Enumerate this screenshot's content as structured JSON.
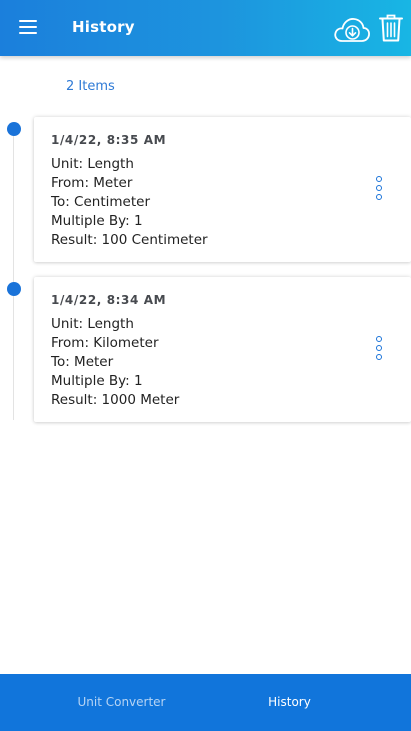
{
  "header": {
    "title": "History",
    "menu_icon": "hamburger-menu-icon",
    "download_icon": "cloud-download-icon",
    "delete_icon": "trash-icon"
  },
  "count_label": "2 Items",
  "history": [
    {
      "date": "1/4/22, 8:35 AM",
      "unit": "Unit: Length",
      "from": "From: Meter",
      "to": "To: Centimeter",
      "multiple": "Multiple By: 1",
      "result": "Result: 100 Centimeter"
    },
    {
      "date": "1/4/22, 8:34 AM",
      "unit": "Unit: Length",
      "from": "From: Kilometer",
      "to": "To: Meter",
      "multiple": "Multiple By: 1",
      "result": "Result: 1000 Meter"
    }
  ],
  "tabs": {
    "converter": "Unit Converter",
    "history": "History",
    "active": "History"
  },
  "colors": {
    "accent": "#1a73d9",
    "bottom_bar": "#1175db"
  }
}
